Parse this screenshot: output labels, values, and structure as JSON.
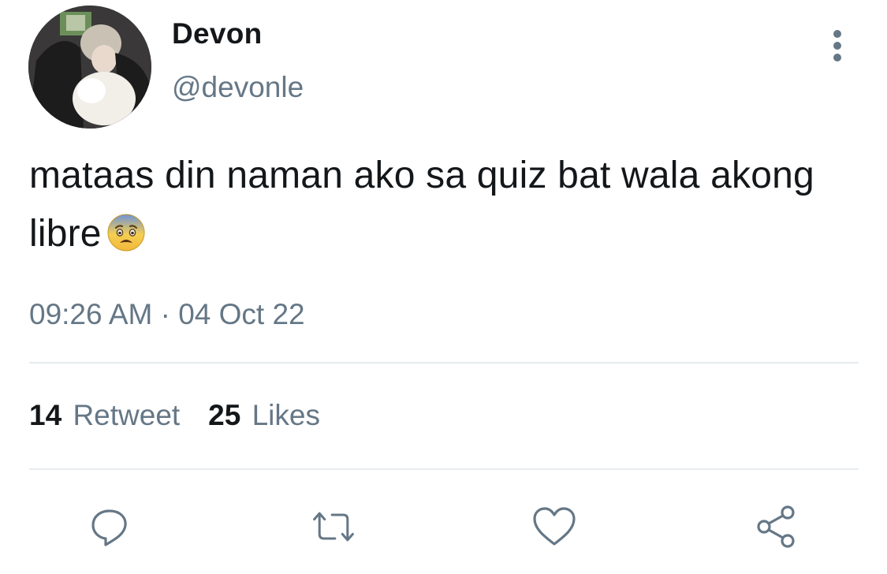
{
  "user": {
    "display_name": "Devon",
    "handle": "@devonle"
  },
  "tweet": {
    "text": "mataas din naman ako sa quiz bat wala akong libre",
    "emoji": "fearful-face-icon",
    "timestamp": "09:26 AM · 04 Oct 22"
  },
  "stats": {
    "retweets": {
      "count": "14",
      "label": "Retweet"
    },
    "likes": {
      "count": "25",
      "label": "Likes"
    }
  },
  "actions": {
    "reply": "reply-icon",
    "retweet": "retweet-icon",
    "like": "heart-icon",
    "share": "share-icon"
  },
  "colors": {
    "text": "#14171a",
    "secondary": "#657786",
    "divider": "#e6ecf0"
  }
}
